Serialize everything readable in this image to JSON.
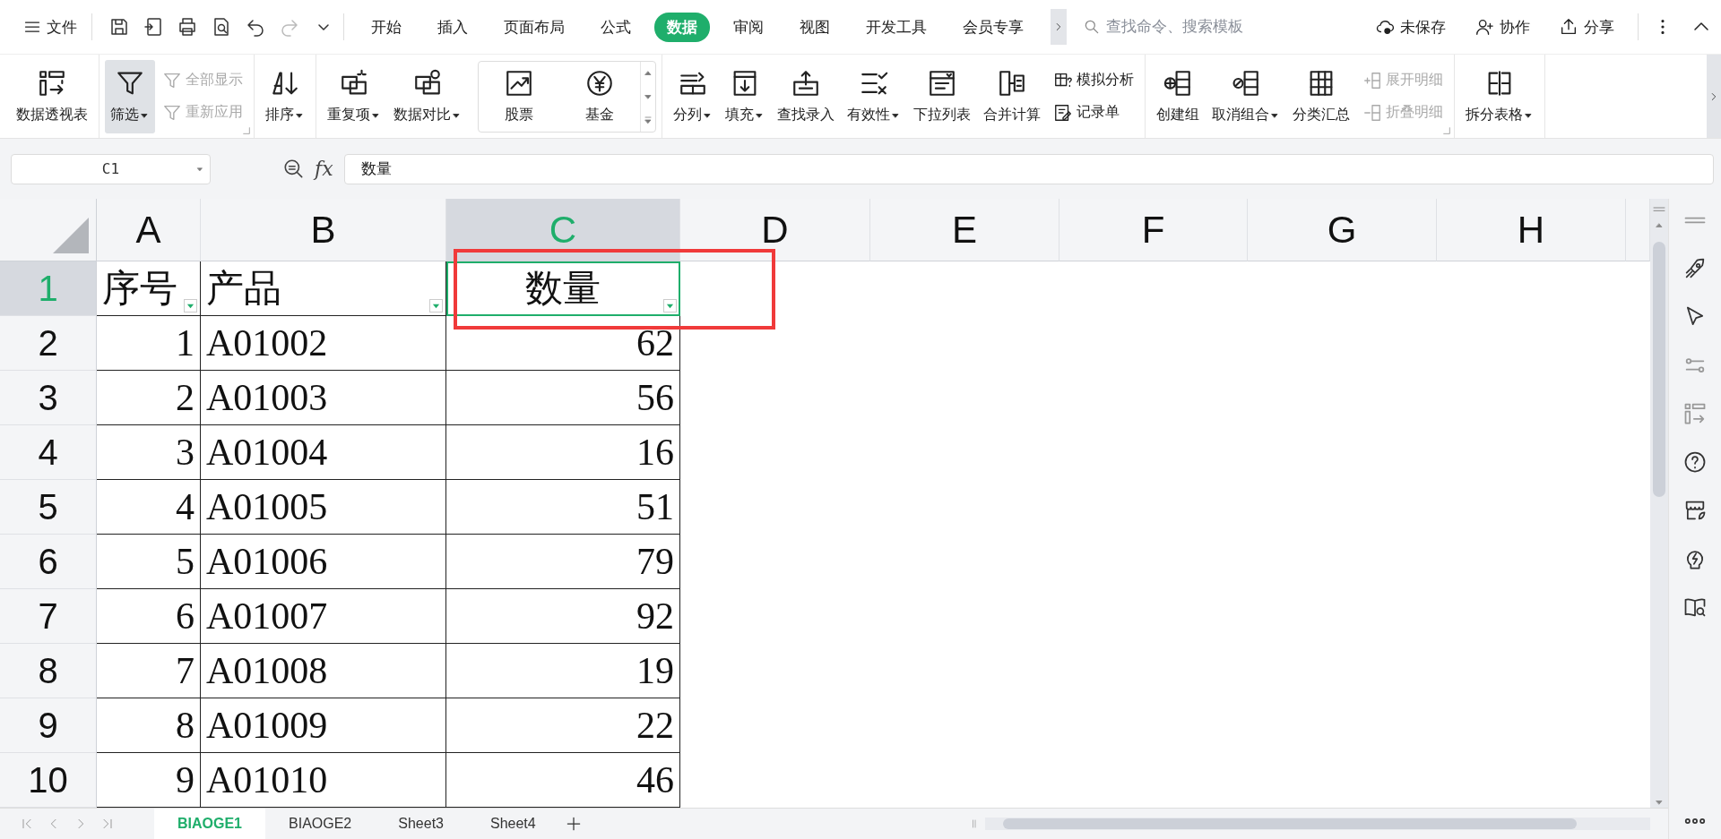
{
  "menu": {
    "label": "文件"
  },
  "tabs": [
    {
      "label": "开始",
      "selected": false
    },
    {
      "label": "插入",
      "selected": false
    },
    {
      "label": "页面布局",
      "selected": false
    },
    {
      "label": "公式",
      "selected": false
    },
    {
      "label": "数据",
      "selected": true
    },
    {
      "label": "审阅",
      "selected": false
    },
    {
      "label": "视图",
      "selected": false
    },
    {
      "label": "开发工具",
      "selected": false
    },
    {
      "label": "会员专享",
      "selected": false
    }
  ],
  "search": {
    "placeholder": "查找命令、搜索模板"
  },
  "actions": [
    "未保存",
    "协作",
    "分享"
  ],
  "ribbon": {
    "groups": [
      {
        "launcher": false,
        "items": [
          {
            "kind": "large",
            "label": "数据透视表",
            "dropdown": false,
            "active": false
          }
        ]
      },
      {
        "launcher": true,
        "items": [
          {
            "kind": "large",
            "label": "筛选",
            "dropdown": true,
            "active": true
          },
          {
            "kind": "stack",
            "items": [
              {
                "label": "全部显示",
                "disabled": true
              },
              {
                "label": "重新应用",
                "disabled": true
              }
            ]
          }
        ]
      },
      {
        "launcher": false,
        "items": [
          {
            "kind": "large",
            "label": "排序",
            "dropdown": true,
            "active": false
          }
        ]
      },
      {
        "launcher": false,
        "items": [
          {
            "kind": "large",
            "label": "重复项",
            "dropdown": true,
            "active": false
          },
          {
            "kind": "large",
            "label": "数据对比",
            "dropdown": true,
            "active": false
          },
          {
            "kind": "gallery",
            "items": [
              {
                "label": "股票"
              },
              {
                "label": "基金"
              }
            ]
          }
        ]
      },
      {
        "launcher": false,
        "items": [
          {
            "kind": "large",
            "label": "分列",
            "dropdown": true,
            "active": false
          },
          {
            "kind": "large",
            "label": "填充",
            "dropdown": true,
            "active": false
          },
          {
            "kind": "large",
            "label": "查找录入",
            "dropdown": false,
            "active": false
          },
          {
            "kind": "large",
            "label": "有效性",
            "dropdown": true,
            "active": false
          },
          {
            "kind": "large",
            "label": "下拉列表",
            "dropdown": false,
            "active": false
          },
          {
            "kind": "large",
            "label": "合并计算",
            "dropdown": false,
            "active": false
          },
          {
            "kind": "stack",
            "items": [
              {
                "label": "模拟分析",
                "disabled": false
              },
              {
                "label": "记录单",
                "disabled": false
              }
            ]
          }
        ]
      },
      {
        "launcher": true,
        "items": [
          {
            "kind": "large",
            "label": "创建组",
            "dropdown": false,
            "active": false
          },
          {
            "kind": "large",
            "label": "取消组合",
            "dropdown": true,
            "active": false
          },
          {
            "kind": "large",
            "label": "分类汇总",
            "dropdown": false,
            "active": false
          },
          {
            "kind": "stack",
            "items": [
              {
                "label": "展开明细",
                "disabled": true
              },
              {
                "label": "折叠明细",
                "disabled": true
              }
            ]
          }
        ]
      },
      {
        "launcher": false,
        "items": [
          {
            "kind": "large",
            "label": "拆分表格",
            "dropdown": true,
            "active": false
          }
        ]
      }
    ]
  },
  "formula_bar": {
    "cell_ref": "C1",
    "fx": "fx",
    "value": "数量"
  },
  "sheet": {
    "columns": [
      {
        "label": "A",
        "selected": false
      },
      {
        "label": "B",
        "selected": false
      },
      {
        "label": "C",
        "selected": true
      },
      {
        "label": "D",
        "selected": false
      },
      {
        "label": "E",
        "selected": false
      },
      {
        "label": "F",
        "selected": false
      },
      {
        "label": "G",
        "selected": false
      },
      {
        "label": "H",
        "selected": false
      }
    ],
    "rows": [
      {
        "number": "1",
        "selected": true,
        "kind": "header",
        "cells": [
          {
            "value": "序号",
            "filter": true,
            "active": false
          },
          {
            "value": "产品",
            "filter": true,
            "active": false
          },
          {
            "value": "数量",
            "filter": true,
            "active": true
          }
        ]
      },
      {
        "number": "2",
        "selected": false,
        "kind": "data",
        "cells": [
          "1",
          "A01002",
          "62"
        ]
      },
      {
        "number": "3",
        "selected": false,
        "kind": "data",
        "cells": [
          "2",
          "A01003",
          "56"
        ]
      },
      {
        "number": "4",
        "selected": false,
        "kind": "data",
        "cells": [
          "3",
          "A01004",
          "16"
        ]
      },
      {
        "number": "5",
        "selected": false,
        "kind": "data",
        "cells": [
          "4",
          "A01005",
          "51"
        ]
      },
      {
        "number": "6",
        "selected": false,
        "kind": "data",
        "cells": [
          "5",
          "A01006",
          "79"
        ]
      },
      {
        "number": "7",
        "selected": false,
        "kind": "data",
        "cells": [
          "6",
          "A01007",
          "92"
        ]
      },
      {
        "number": "8",
        "selected": false,
        "kind": "data",
        "cells": [
          "7",
          "A01008",
          "19"
        ]
      },
      {
        "number": "9",
        "selected": false,
        "kind": "data",
        "cells": [
          "8",
          "A01009",
          "22"
        ]
      },
      {
        "number": "10",
        "selected": false,
        "kind": "data",
        "cells": [
          "9",
          "A01010",
          "46"
        ]
      }
    ]
  },
  "sheet_tabs": [
    {
      "label": "BIAOGE1",
      "selected": true
    },
    {
      "label": "BIAOGE2",
      "selected": false
    },
    {
      "label": "Sheet3",
      "selected": false
    },
    {
      "label": "Sheet4",
      "selected": false
    }
  ]
}
